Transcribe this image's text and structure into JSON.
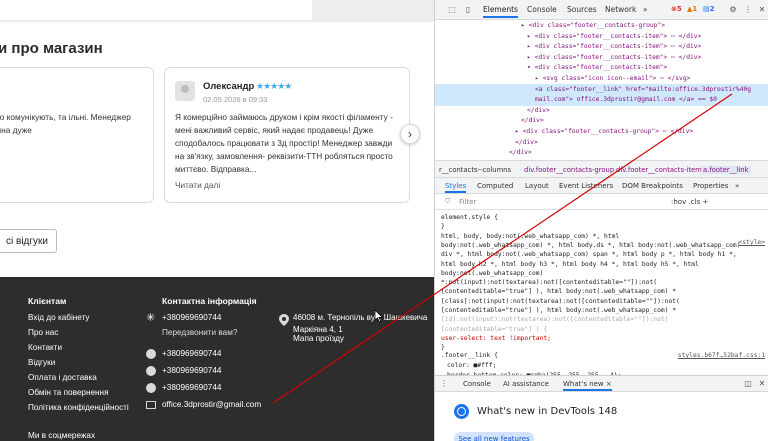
{
  "site": {
    "reviews_title": "и про магазин",
    "left_review_text": "сно комунікують, та  ільні. Менеджер Анна дуже",
    "main_review": {
      "name": "Олександр",
      "stars": "★★★★★",
      "date": "02.05.2026 в 09:33",
      "text": "Я комерційно займаюсь друком і крім якості філаменту - мені важливий сервіс, який надає продавець! Дуже сподобалось працювати з 3д простір! Менеджер завжди на зв'язку, замовлення- реквізити-ТТН робляться просто миттєво. Відправка...",
      "read_more": "Читати далі"
    },
    "next_glyph": "›",
    "all_reviews_label": "сі відгуки",
    "footer": {
      "clients_title": "Клієнтам",
      "clients_links": [
        "Вхід до кабінету",
        "Про нас",
        "Контакти",
        "Відгуки",
        "Оплата і доставка",
        "Обмін та повернення",
        "Політика конфіденційності"
      ],
      "contacts_title": "Контактна інформація",
      "phone_main": "+380969690744",
      "callback_label": "Передзвонити вам?",
      "phones": [
        "+380969690744",
        "+380969690744",
        "+380969690744"
      ],
      "email": "office.3dprostir@gmail.com",
      "address": "46008 м. Тернопіль вул. Шашкевича Маркіяна 4, 1",
      "map_link": "Мапа проїзду",
      "social_title": "Ми в соцмережах"
    }
  },
  "devtools": {
    "tabs": [
      "Elements",
      "Console",
      "Sources",
      "Network"
    ],
    "more_tabs": "»",
    "errors": "5",
    "warnings": "1",
    "issues": "2",
    "dom_lines": [
      {
        "indent": 86,
        "html": "▸ <div class=\"footer__contacts-group\">"
      },
      {
        "indent": 92,
        "html": "▸ <div class=\"footer__contacts-item\"> ⋯ </div>"
      },
      {
        "indent": 92,
        "html": "▸ <div class=\"footer__contacts-item\"> ⋯ </div>"
      },
      {
        "indent": 92,
        "html": "▸ <div class=\"footer__contacts-item\"> ⋯ </div>"
      },
      {
        "indent": 92,
        "html": "▾ <div class=\"footer__contacts-item\">"
      },
      {
        "indent": 100,
        "html": "▸ <svg class=\"icon icon--email\"> ⋯ </svg>"
      },
      {
        "indent": 100,
        "html": "<a class=\"footer__link\" href=\"mailto:office.3dprostir%40g"
      },
      {
        "indent": 100,
        "html": "mail.com\"> office.3dprostir@gmail.com </a> == $0"
      },
      {
        "indent": 92,
        "html": "</div>"
      },
      {
        "indent": 86,
        "html": "</div>"
      },
      {
        "indent": 80,
        "html": "▸ <div class=\"footer__contacts-group\"> ⋯ </div>"
      },
      {
        "indent": 80,
        "html": "</div>"
      },
      {
        "indent": 74,
        "html": "</div>"
      }
    ],
    "crumbs": [
      "r__contacts--columns",
      "div.footer__contacts-group",
      "div.footer__contacts-item",
      "a.footer__link"
    ],
    "subtabs": [
      "Styles",
      "Computed",
      "Layout",
      "Event Listeners",
      "DOM Breakpoints",
      "Properties",
      "»"
    ],
    "filter_placeholder": "Filter",
    "filter_tools": ":hov  .cls  +",
    "styles_lines": [
      "element.style {",
      "}",
      "html, body, body:not(.web_whatsapp_com) *, html",
      "body:not(.web_whatsapp_com) *, html body.ds *, html body:not(.web_whatsapp_com)",
      "div *, html body:not(.web_whatsapp_com) span *, html body p *, html body h1 *,",
      "html body h2 *, html body h3 *, html body h4 *, html body h5 *, html",
      "body:not(.web_whatsapp_com)",
      "*:not(input):not(textarea):not([contenteditable=\"\"]):not(",
      "[contenteditable=\"true\"] ), html body:not(.web_whatsapp_com) *",
      "[class]:not(input):not(textarea):not([contenteditable=\"\"]):not(",
      "[contenteditable=\"true\"] ), html body:not(.web_whatsapp_com) *",
      "[id]:not(input):not(textarea):not([contenteditable=\"\"]):not(",
      "[contenteditable=\"true\"] ) {",
      "  user-select: text !important;",
      "}"
    ],
    "styles_source1": "<style>",
    "footer_link_rule": ".footer__link {",
    "footer_link_source": "styles.b67f…52baf.css:1",
    "footer_link_props": [
      "color: ■#fff;",
      "border-bottom-color: ■rgba(255, 255, 255, .4);"
    ],
    "drawer_tabs": [
      "Console",
      "AI assistance",
      "What's new ×"
    ],
    "whats_new_title": "What's new in DevTools 148",
    "see_all": "See all new features"
  },
  "colors": {
    "footer_bg": "#2d2d2d",
    "star": "#4aa9e8",
    "selection": "#cfe8fc",
    "accent": "#1a73e8",
    "annotation_line": "#d50000"
  }
}
